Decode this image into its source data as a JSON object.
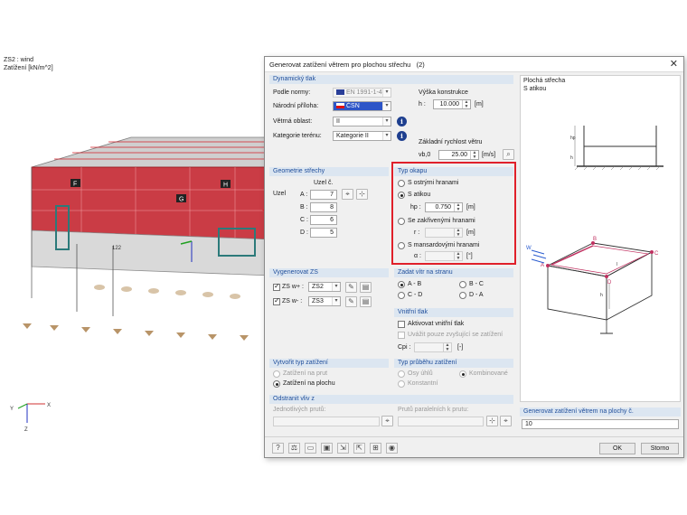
{
  "viewport": {
    "load_case": "ZS2 : wind",
    "load_unit": "Zatížení [kN/m^2]",
    "zone_labels": [
      "F",
      "G",
      "H"
    ],
    "member_label": "122",
    "axes": {
      "x": "X",
      "y": "Y",
      "z": "Z"
    }
  },
  "dialog": {
    "title": "Generovat zatížení větrem pro plochou střechu",
    "title_index": "(2)",
    "close_glyph": "✕",
    "dynamic": {
      "header": "Dynamický tlak",
      "standard_label": "Podle normy:",
      "standard_value": "EN 1991-1-4",
      "annex_label": "Národní příloha:",
      "annex_value": "ČSN",
      "wind_zone_label": "Větrná oblast:",
      "wind_zone_value": "II",
      "terrain_label": "Kategorie terénu:",
      "terrain_value": "Kategorie II",
      "height_label": "Výška konstrukce",
      "h_label": "h :",
      "h_value": "10.000",
      "h_unit": "[m]",
      "vb_label": "Základní rychlost větru",
      "vb_symbol": "vb,0",
      "vb_value": "25.00",
      "vb_unit": "[m/s]"
    },
    "geometry": {
      "header": "Geometrie střechy",
      "node_label": "Uzel",
      "node_no_label": "Uzel č.",
      "nodes": [
        {
          "label": "A :",
          "value": "7"
        },
        {
          "label": "B :",
          "value": "8"
        },
        {
          "label": "C :",
          "value": "6"
        },
        {
          "label": "D :",
          "value": "5"
        }
      ]
    },
    "eaves": {
      "header": "Typ okapu",
      "sharp": "S ostrými hranami",
      "parapet": "S atikou",
      "hp_label": "hp :",
      "hp_value": "0.750",
      "hp_unit": "[m]",
      "curved": "Se zakřivenými hranami",
      "r_label": "r :",
      "r_unit": "[m]",
      "mansard": "S mansardovými hranami",
      "alpha_label": "α :",
      "alpha_unit": "[°]"
    },
    "generate": {
      "header": "Vygenerovat ZS",
      "plus_label": "ZS w+ :",
      "plus_value": "ZS2",
      "minus_label": "ZS w- :",
      "minus_value": "ZS3"
    },
    "direction": {
      "header": "Zadat vítr na stranu",
      "options": [
        "A - B",
        "B - C",
        "C - D",
        "D - A"
      ]
    },
    "internal": {
      "header": "Vnitřní tlak",
      "activate": "Aktivovat vnitřní tlak",
      "only_increasing": "Uvážit pouze zvyšující se zatížení",
      "cpi_label": "Cpi :",
      "cpi_unit": "[-]"
    },
    "load_type": {
      "header": "Vytvořit typ zatížení",
      "member": "Zatížení na prut",
      "surface": "Zatížení na plochu"
    },
    "course": {
      "header": "Typ průběhu zatížení",
      "angular": "Osy úhlů",
      "combined": "Kombinované",
      "constant": "Konstantní"
    },
    "remove": {
      "header": "Odstranit vliv z",
      "individual": "Jednotlivých prutů:",
      "parallel": "Prutů paralelních k prutu:"
    },
    "preview": {
      "title": "Plochá střecha",
      "subtitle": "S atikou",
      "labels": {
        "w": "W",
        "a": "A",
        "b": "B",
        "c": "C",
        "d": "D",
        "h": "h",
        "hp": "hp",
        "l": "l"
      }
    },
    "result": {
      "header": "Generovat zatížení větrem na plochy č.",
      "value": "10"
    },
    "ok_label": "OK",
    "cancel_label": "Storno"
  },
  "colors": {
    "highlight": "#e0202a",
    "load_red": "#d4202a",
    "header_bg": "#dce6f1",
    "header_text": "#1f4e9b",
    "info_blue": "#1e3f8f"
  }
}
